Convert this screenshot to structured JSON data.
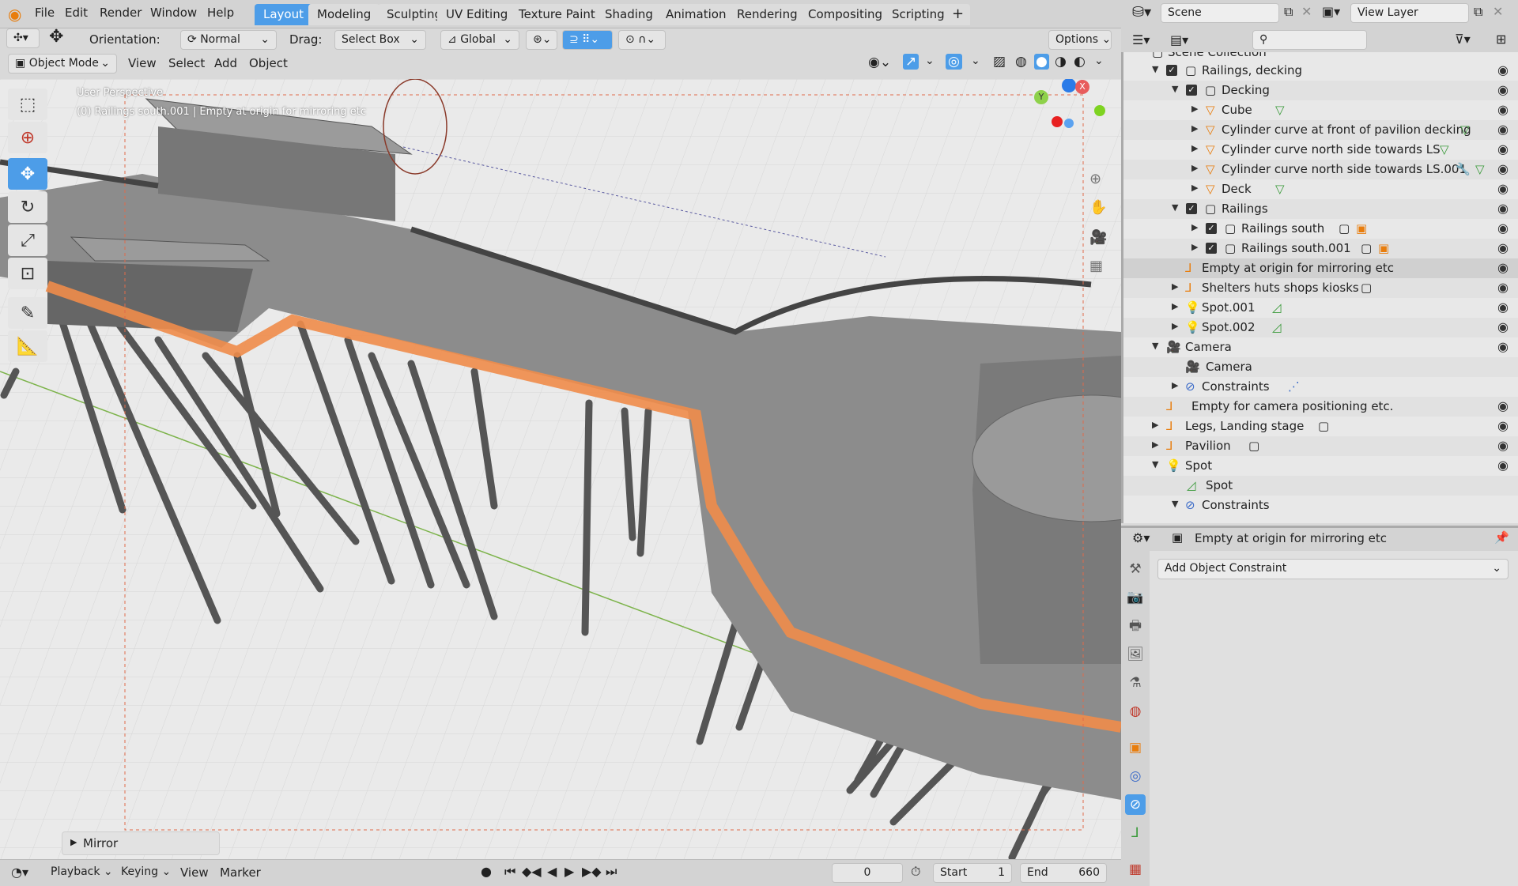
{
  "topbar": {
    "menus": [
      "File",
      "Edit",
      "Render",
      "Window",
      "Help"
    ],
    "workspaces": [
      "Layout",
      "Modeling",
      "Sculpting",
      "UV Editing",
      "Texture Paint",
      "Shading",
      "Animation",
      "Rendering",
      "Compositing",
      "Scripting"
    ],
    "active_workspace": "Layout",
    "add_workspace": "+",
    "scene_label": "Scene",
    "view_layer_label": "View Layer"
  },
  "viewport_header": {
    "orientation_label": "Orientation:",
    "orientation_value": "Normal",
    "drag_label": "Drag:",
    "drag_value": "Select Box",
    "transform_orientation": "Global",
    "options_label": "Options",
    "mode": "Object Mode",
    "menus": [
      "View",
      "Select",
      "Add",
      "Object"
    ]
  },
  "viewport": {
    "perspective_label": "User Perspective",
    "selection_info": "(0) Railings south.001 | Empty at origin for mirroring etc",
    "gizmo_axes": {
      "x": "X",
      "y": "Y",
      "z": "Z"
    },
    "last_op_panel": "Mirror"
  },
  "timeline": {
    "menus": [
      "Playback",
      "Keying",
      "View",
      "Marker"
    ],
    "current_frame": "0",
    "start_label": "Start",
    "start_value": "1",
    "end_label": "End",
    "end_value": "660"
  },
  "outliner": {
    "search_placeholder": "",
    "rows": [
      {
        "label": "Scene Collection",
        "indent": 0
      },
      {
        "label": "Railings, decking",
        "indent": 1
      },
      {
        "label": "Decking",
        "indent": 2
      },
      {
        "label": "Cube",
        "indent": 3
      },
      {
        "label": "Cylinder curve at front of pavilion decking",
        "indent": 3
      },
      {
        "label": "Cylinder curve north side towards LS",
        "indent": 3
      },
      {
        "label": "Cylinder curve north side towards LS.001",
        "indent": 3
      },
      {
        "label": "Deck",
        "indent": 3
      },
      {
        "label": "Railings",
        "indent": 2
      },
      {
        "label": "Railings south",
        "indent": 3
      },
      {
        "label": "Railings south.001",
        "indent": 3
      },
      {
        "label": "Empty at origin for mirroring etc",
        "indent": 2
      },
      {
        "label": "Shelters huts shops kiosks",
        "indent": 2
      },
      {
        "label": "Spot.001",
        "indent": 2
      },
      {
        "label": "Spot.002",
        "indent": 2
      },
      {
        "label": "Camera",
        "indent": 1
      },
      {
        "label": "Camera",
        "indent": 2
      },
      {
        "label": "Constraints",
        "indent": 2
      },
      {
        "label": "Empty for camera positioning etc.",
        "indent": 1
      },
      {
        "label": "Legs, Landing stage",
        "indent": 1
      },
      {
        "label": "Pavilion",
        "indent": 1
      },
      {
        "label": "Spot",
        "indent": 1
      },
      {
        "label": "Spot",
        "indent": 2
      },
      {
        "label": "Constraints",
        "indent": 2
      }
    ]
  },
  "properties": {
    "object_name": "Empty at origin for mirroring etc",
    "add_constraint_label": "Add Object Constraint"
  },
  "colors": {
    "accent": "#4d9de8",
    "selection_orange": "#f08c4a",
    "header_bg": "#d3d3d3"
  }
}
